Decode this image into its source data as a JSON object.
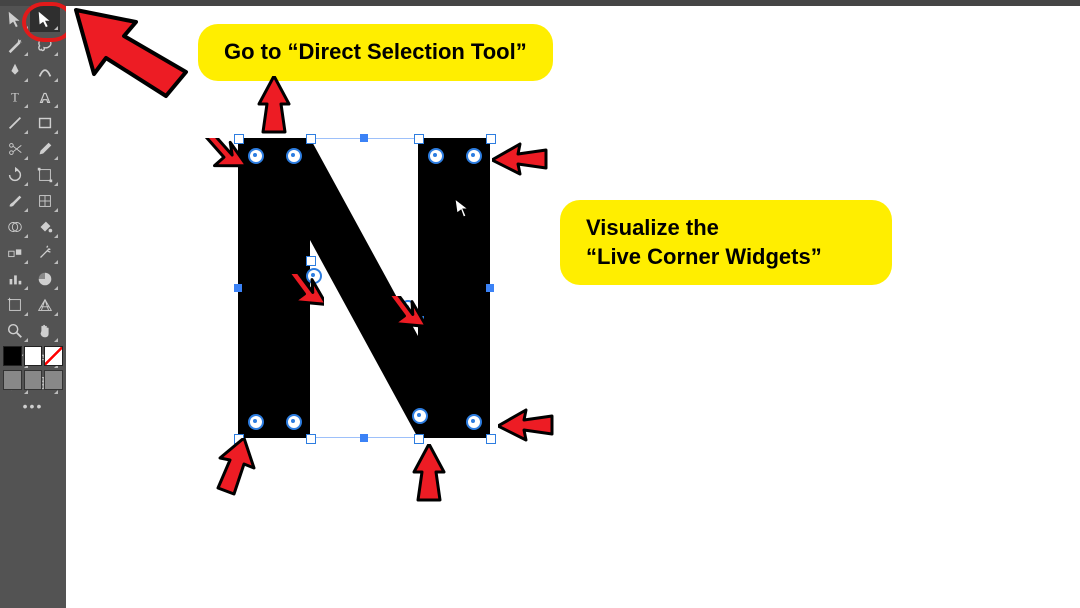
{
  "callouts": {
    "top": "Go to “Direct Selection Tool”",
    "right_line1": "Visualize the",
    "right_line2": "“Live Corner Widgets”"
  },
  "toolbar": {
    "tools": [
      {
        "name": "selection-tool"
      },
      {
        "name": "direct-selection-tool",
        "selected": true
      },
      {
        "name": "magic-wand-tool"
      },
      {
        "name": "lasso-tool"
      },
      {
        "name": "pen-tool"
      },
      {
        "name": "curvature-tool"
      },
      {
        "name": "type-tool"
      },
      {
        "name": "touch-type-tool"
      },
      {
        "name": "line-segment-tool"
      },
      {
        "name": "rectangle-tool"
      },
      {
        "name": "paintbrush-tool"
      },
      {
        "name": "blob-brush-tool"
      },
      {
        "name": "shaper-tool"
      },
      {
        "name": "eraser-tool"
      },
      {
        "name": "rotate-tool"
      },
      {
        "name": "scale-tool"
      },
      {
        "name": "width-tool"
      },
      {
        "name": "free-transform-tool"
      },
      {
        "name": "shape-builder-tool"
      },
      {
        "name": "live-paint-bucket"
      },
      {
        "name": "perspective-grid-tool"
      },
      {
        "name": "mesh-tool"
      },
      {
        "name": "gradient-tool"
      },
      {
        "name": "eyedropper-tool"
      },
      {
        "name": "blend-tool"
      },
      {
        "name": "symbol-sprayer-tool"
      },
      {
        "name": "column-graph-tool"
      },
      {
        "name": "artboard-tool"
      },
      {
        "name": "slice-tool"
      },
      {
        "name": "hand-tool"
      },
      {
        "name": "zoom-tool"
      }
    ],
    "more_label": "•••"
  },
  "colors": {
    "toolbar_bg": "#535353",
    "callout_bg": "#ffee00",
    "arrow_fill": "#ed1c24"
  },
  "cursor_name": "direct-selection-cursor"
}
